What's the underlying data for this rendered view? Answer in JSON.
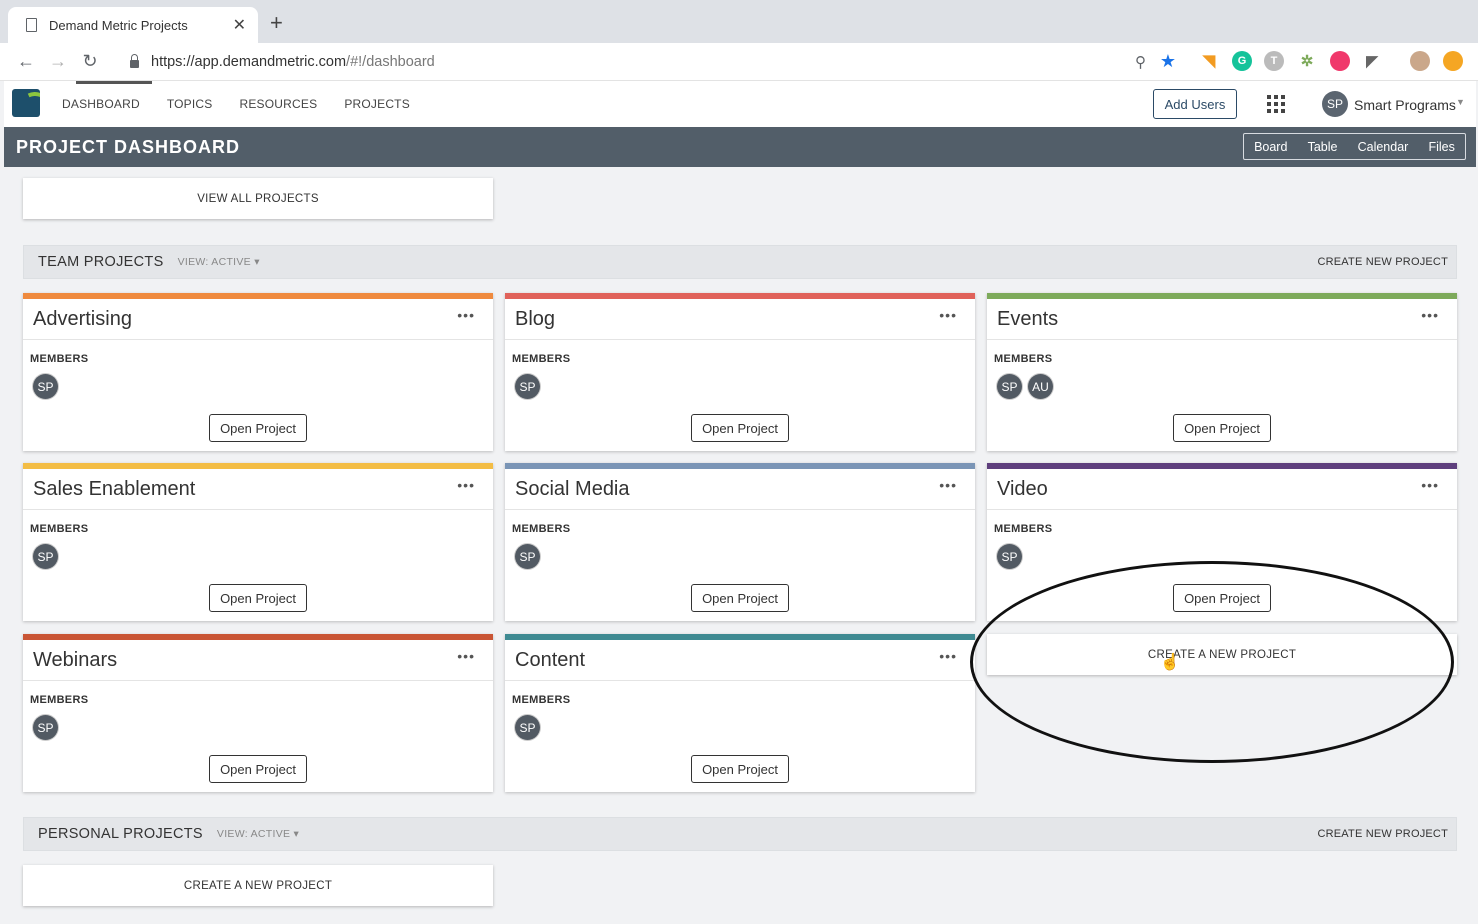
{
  "browser": {
    "tab_title": "Demand Metric Projects",
    "url_host": "https://app.demandmetric.com",
    "url_path": "/#!/dashboard"
  },
  "colors": {
    "header_bar": "#525e69",
    "advertising": "#ef8a3e",
    "blog": "#e0625a",
    "events": "#7daa5a",
    "sales": "#f3bd45",
    "social": "#7a95b6",
    "video": "#5e3f7d",
    "webinars": "#c95535",
    "content": "#3f8a92"
  },
  "nav": {
    "items": [
      "DASHBOARD",
      "TOPICS",
      "RESOURCES",
      "PROJECTS"
    ]
  },
  "header": {
    "add_users": "Add Users",
    "user_initials": "SP",
    "user_name": "Smart Programs"
  },
  "titlebar": {
    "title": "PROJECT DASHBOARD",
    "views": [
      "Board",
      "Table",
      "Calendar",
      "Files"
    ]
  },
  "view_all": "VIEW ALL PROJECTS",
  "team": {
    "title": "TEAM PROJECTS",
    "view": "VIEW: ACTIVE ▾",
    "create": "CREATE NEW PROJECT",
    "projects": [
      {
        "name": "Advertising",
        "members_label": "MEMBERS",
        "members": [
          "SP"
        ],
        "button": "Open Project"
      },
      {
        "name": "Blog",
        "members_label": "MEMBERS",
        "members": [
          "SP"
        ],
        "button": "Open Project"
      },
      {
        "name": "Events",
        "members_label": "MEMBERS",
        "members": [
          "SP",
          "AU"
        ],
        "button": "Open Project"
      },
      {
        "name": "Sales Enablement",
        "members_label": "MEMBERS",
        "members": [
          "SP"
        ],
        "button": "Open Project"
      },
      {
        "name": "Social Media",
        "members_label": "MEMBERS",
        "members": [
          "SP"
        ],
        "button": "Open Project"
      },
      {
        "name": "Video",
        "members_label": "MEMBERS",
        "members": [
          "SP"
        ],
        "button": "Open Project"
      },
      {
        "name": "Webinars",
        "members_label": "MEMBERS",
        "members": [
          "SP"
        ],
        "button": "Open Project"
      },
      {
        "name": "Content",
        "members_label": "MEMBERS",
        "members": [
          "SP"
        ],
        "button": "Open Project"
      }
    ],
    "create_card": "CREATE A NEW PROJECT"
  },
  "personal": {
    "title": "PERSONAL PROJECTS",
    "view": "VIEW: ACTIVE ▾",
    "create": "CREATE NEW PROJECT",
    "create_card": "CREATE A NEW PROJECT"
  }
}
